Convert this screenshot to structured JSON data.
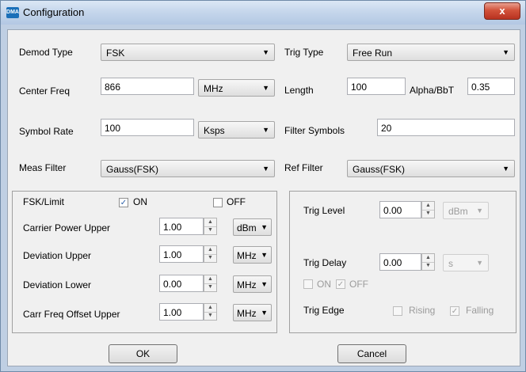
{
  "window": {
    "title": "Configuration",
    "app_icon_text": "DMA",
    "close_glyph": "x"
  },
  "main": {
    "demod_type": {
      "label": "Demod Type",
      "value": "FSK"
    },
    "center_freq": {
      "label": "Center Freq",
      "value": "866",
      "unit": "MHz"
    },
    "symbol_rate": {
      "label": "Symbol Rate",
      "value": "100",
      "unit": "Ksps"
    },
    "meas_filter": {
      "label": "Meas Filter",
      "value": "Gauss(FSK)"
    },
    "trig_type": {
      "label": "Trig Type",
      "value": "Free Run"
    },
    "length": {
      "label": "Length",
      "value": "100"
    },
    "alpha_bbt": {
      "label": "Alpha/BbT",
      "value": "0.35"
    },
    "filter_symbols": {
      "label": "Filter Symbols",
      "value": "20"
    },
    "ref_filter": {
      "label": "Ref Filter",
      "value": "Gauss(FSK)"
    }
  },
  "limits": {
    "fsk_limit_label": "FSK/Limit",
    "on_label": "ON",
    "on_checked": true,
    "off_label": "OFF",
    "off_checked": false,
    "carrier_power_upper": {
      "label": "Carrier Power Upper",
      "value": "1.00",
      "unit": "dBm"
    },
    "deviation_upper": {
      "label": "Deviation Upper",
      "value": "1.00",
      "unit": "MHz"
    },
    "deviation_lower": {
      "label": "Deviation Lower",
      "value": "0.00",
      "unit": "MHz"
    },
    "carr_freq_offset_upper": {
      "label": "Carr Freq Offset Upper",
      "value": "1.00",
      "unit": "MHz"
    }
  },
  "trigger": {
    "trig_level": {
      "label": "Trig Level",
      "value": "0.00",
      "unit": "dBm"
    },
    "trig_delay": {
      "label": "Trig Delay",
      "value": "0.00",
      "unit": "s"
    },
    "delay_on_label": "ON",
    "delay_on_checked": false,
    "delay_off_label": "OFF",
    "delay_off_checked": true,
    "trig_edge": {
      "label": "Trig Edge",
      "rising_label": "Rising",
      "rising_checked": false,
      "falling_label": "Falling",
      "falling_checked": true
    }
  },
  "buttons": {
    "ok": "OK",
    "cancel": "Cancel"
  },
  "icons": {
    "dropdown": "chevron-down-icon",
    "spin": "spin-arrows-icon",
    "check": "check-icon"
  },
  "colors": {
    "title_gradient": "#c6d7ec",
    "close_button": "#d2523a",
    "dialog_bg": "#f0f0f0"
  }
}
